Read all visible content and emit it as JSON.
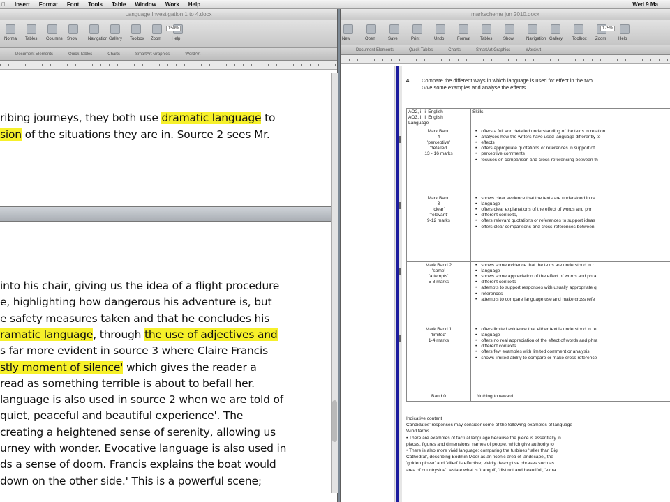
{
  "menubar": {
    "items": [
      "Insert",
      "Format",
      "Font",
      "Tools",
      "Table",
      "Window",
      "Work",
      "Help"
    ],
    "clock": "Wed 9 Ma"
  },
  "left_window": {
    "title": "Language Investigation 1 to 4.docx",
    "toolbar_labels": [
      "Normal",
      "Tables",
      "Columns",
      "Show",
      "Navigation",
      "Gallery",
      "Toolbox",
      "Zoom",
      "Help"
    ],
    "zoom": "150%",
    "ribbon_tabs": [
      "Document Elements",
      "Quick Tables",
      "Charts",
      "SmartArt Graphics",
      "WordArt"
    ],
    "top_pane_lines": [
      {
        "parts": [
          {
            "t": "ribing journeys, they both use ",
            "h": false
          },
          {
            "t": "dramatic language",
            "h": true
          },
          {
            "t": " to",
            "h": false
          }
        ]
      },
      {
        "parts": [
          {
            "t": "sion",
            "h": true
          },
          {
            "t": " of the situations they are in. Source 2 sees Mr.",
            "h": false
          }
        ]
      }
    ],
    "bottom_pane_lines": [
      {
        "parts": [
          {
            "t": "into his chair, giving us the idea of a flight procedure",
            "h": false
          }
        ]
      },
      {
        "parts": [
          {
            "t": "e, highlighting how dangerous his adventure is, but",
            "h": false
          }
        ]
      },
      {
        "parts": [
          {
            "t": "e safety measures taken and that he concludes his",
            "h": false
          }
        ]
      },
      {
        "parts": [
          {
            "t": "ramatic language",
            "h": true
          },
          {
            "t": ", through ",
            "h": false
          },
          {
            "t": "the use of adjectives and",
            "h": true
          }
        ]
      },
      {
        "parts": [
          {
            "t": "s far more evident in source 3 where Claire Francis",
            "h": false
          }
        ]
      },
      {
        "parts": [
          {
            "t": "stly moment of silence'",
            "h": true
          },
          {
            "t": " which gives the reader a",
            "h": false
          }
        ]
      },
      {
        "parts": [
          {
            "t": "read as something terrible is about to befall her.",
            "h": false
          }
        ]
      },
      {
        "parts": [
          {
            "t": "language is also used in source 2 when we are told of",
            "h": false
          }
        ]
      },
      {
        "parts": [
          {
            "t": "quiet, peaceful and beautiful experience'. The",
            "h": false
          }
        ]
      },
      {
        "parts": [
          {
            "t": "creating a heightened sense of serenity, allowing us",
            "h": false
          }
        ]
      },
      {
        "parts": [
          {
            "t": "urney with wonder. Evocative language is also used in",
            "h": false
          }
        ]
      },
      {
        "parts": [
          {
            "t": "ds a sense of doom. Francis explains the boat would",
            "h": false
          }
        ]
      },
      {
        "parts": [
          {
            "t": " down on the other side.' This is a powerful scene;",
            "h": false
          }
        ]
      }
    ]
  },
  "right_window": {
    "title": "markscheme jun 2010.docx",
    "toolbar_labels": [
      "New",
      "Open",
      "Save",
      "Print",
      "Undo",
      "Format",
      "Tables",
      "Show",
      "Navigation",
      "Gallery",
      "Toolbox",
      "Zoom",
      "Help"
    ],
    "zoom": "175%",
    "ribbon_tabs": [
      "Document Elements",
      "Quick Tables",
      "Charts",
      "SmartArt Graphics",
      "WordArt"
    ],
    "question_number": "4",
    "question_lines": [
      "Compare the different ways in which language is used for effect in the two",
      "Give some examples and analyse the effects."
    ],
    "header_left": [
      "AO2, i, iii English",
      "AO3, i, iii English",
      "Language"
    ],
    "header_right": "Skills",
    "bands": [
      {
        "label": [
          "Mark Band",
          "4",
          "'perceptive'",
          "'detailed'",
          "13 - 16 marks"
        ],
        "skills": [
          "offers a full and detailed understanding  of the texts in relation",
          "analyses how the writers have used language differently to",
          "effects",
          "offers appropriate quotations or references in support of",
          "perceptive comments",
          "focuses on comparison and cross-referencing between th"
        ]
      },
      {
        "label": [
          "Mark Band",
          "3",
          "'clear'",
          "'relevant'",
          "9-12 marks"
        ],
        "skills": [
          "shows clear  evidence that the texts are understood in re",
          "language",
          "offers  clear  explanations  of the effect of words and phr",
          "different contexts,",
          "offers relevant  quotations or references to support ideas",
          "offers clear comparisons and cross-references between"
        ]
      },
      {
        "label": [
          "Mark Band 2",
          "'some'",
          "'attempts'",
          "5-8 marks"
        ],
        "skills": [
          "shows some  evidence that the texts are understood in r",
          "language",
          "shows some appreciation of the effect of words and phra",
          "different contexts",
          "attempts to support responses with usually appropriate q",
          "references",
          "attempts  to compare language use and make cross refe"
        ]
      },
      {
        "label": [
          "Mark Band 1",
          "'limited'",
          "1-4 marks"
        ],
        "skills": [
          "offers limited evidence that either text is understood in re",
          "language",
          "offers no real appreciation of the effect of words and phra",
          "different contexts",
          "offers few examples with limited comment or analysis",
          "shows limited ability to compare or make cross reference"
        ]
      },
      {
        "label": [
          "Band 0"
        ],
        "skills": [
          "Nothing to reward"
        ]
      }
    ],
    "indicative_lines": [
      "Indicative content",
      "Candidates' responses may consider some of the following examples of language",
      "Wind farms",
      "•    There are examples of factual language because the piece is essentially in",
      "      places, figures and dimensions; names of people, which give authority to",
      "•    There is also more vivid language: comparing the turbines 'taller than Big",
      "      Cathedral', describing Bodmin Moor as an 'iconic area of landscape',  the",
      "      'golden plover' and 'killed' is effective; vividly descriptive phrases such as",
      "      area of countryside', 'estate what is 'tranquil', 'distinct and beautiful', 'extra"
    ]
  }
}
